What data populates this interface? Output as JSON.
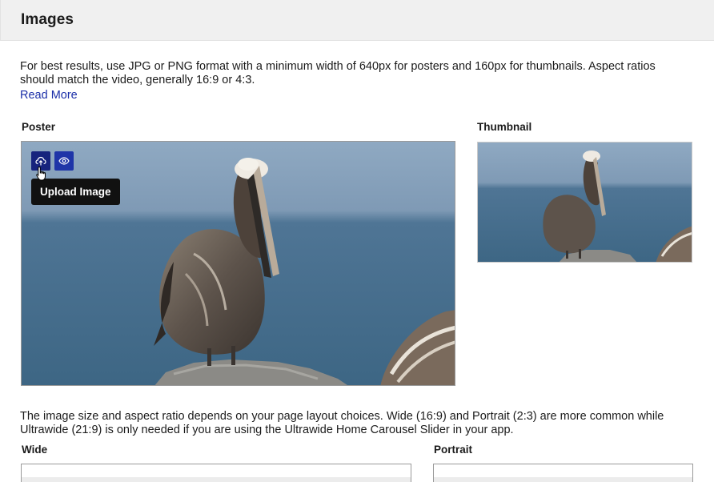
{
  "header": {
    "title": "Images"
  },
  "intro": {
    "text": "For best results, use JPG or PNG format with a minimum width of 640px for posters and 160px for thumbnails. Aspect ratios should match the video, generally 16:9 or 4:3.",
    "read_more": "Read More"
  },
  "poster": {
    "label": "Poster",
    "upload_icon": "cloud-upload-icon",
    "preview_icon": "eye-icon",
    "tooltip": "Upload Image"
  },
  "thumbnail": {
    "label": "Thumbnail"
  },
  "layout_note": "The image size and aspect ratio depends on your page layout choices. Wide (16:9) and Portrait (2:3) are more common while Ultrawide (21:9) is only needed if you are using the Ultrawide Home Carousel Slider in your app.",
  "wide": {
    "label": "Wide"
  },
  "portrait": {
    "label": "Portrait"
  },
  "colors": {
    "icon_button": "#1f35a8",
    "icon_button_active": "#16237d",
    "link": "#1a2ea8",
    "tooltip_bg": "#111111",
    "header_bg": "#f0f0f0"
  }
}
